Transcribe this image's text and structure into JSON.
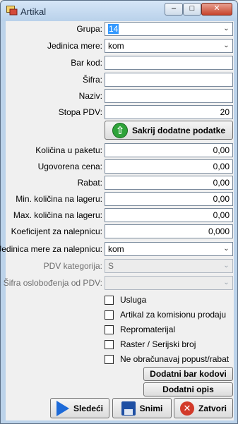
{
  "window": {
    "title": "Artikal"
  },
  "fields": {
    "grupa": {
      "label": "Grupa:",
      "value": "14"
    },
    "jedinica_mere": {
      "label": "Jedinica mere:",
      "value": "kom"
    },
    "bar_kod": {
      "label": "Bar kod:",
      "value": ""
    },
    "sifra": {
      "label": "Šifra:",
      "value": ""
    },
    "naziv": {
      "label": "Naziv:",
      "value": ""
    },
    "stopa_pdv": {
      "label": "Stopa PDV:",
      "value": "20"
    },
    "kolicina_u_paketu": {
      "label": "Količina u paketu:",
      "value": "0,00"
    },
    "ugovorena_cena": {
      "label": "Ugovorena cena:",
      "value": "0,00"
    },
    "rabat": {
      "label": "Rabat:",
      "value": "0,00"
    },
    "min_kolicina": {
      "label": "Min. količina na lageru:",
      "value": "0,00"
    },
    "max_kolicina": {
      "label": "Max. količina na lageru:",
      "value": "0,00"
    },
    "koeficijent": {
      "label": "Koeficijent za nalepnicu:",
      "value": "0,000"
    },
    "jedinica_nalepnica": {
      "label": "Jedinica mere za nalepnicu:",
      "value": "kom"
    },
    "pdv_kategorija": {
      "label": "PDV kategorija:",
      "value": "S"
    },
    "sifra_oslobodjenja": {
      "label": "Šifra oslobođenja od PDV:",
      "value": ""
    }
  },
  "buttons": {
    "sakrij": "Sakrij dodatne podatke",
    "dodatni_bar_kodovi": "Dodatni bar kodovi",
    "dodatni_opis": "Dodatni opis",
    "sledeci": "Sledeći",
    "snimi": "Snimi",
    "zatvori": "Zatvori"
  },
  "checkboxes": [
    {
      "label": "Usluga",
      "checked": false
    },
    {
      "label": "Artikal za komisionu prodaju",
      "checked": false
    },
    {
      "label": "Repromaterijal",
      "checked": false
    },
    {
      "label": "Raster / Serijski broj",
      "checked": false
    },
    {
      "label": "Ne obračunavaj popust/rabat",
      "checked": false
    }
  ],
  "icons": {
    "app": "form-icon",
    "sakrij": "arrow-up-circle-icon",
    "sledeci": "play-icon",
    "snimi": "floppy-disk-icon",
    "zatvori": "close-circle-icon"
  },
  "colors": {
    "selection": "#3399ff",
    "titlebar": "#c6dcf1",
    "close_button": "#c7432b"
  }
}
